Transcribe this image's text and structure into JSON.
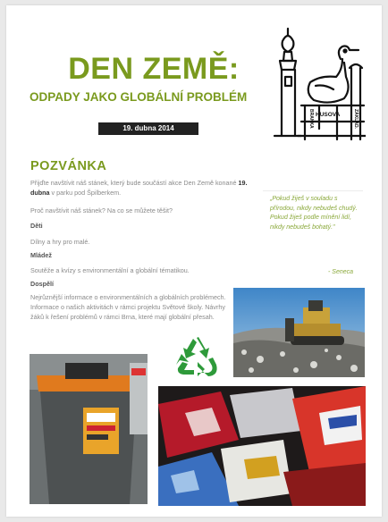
{
  "title": "DEN ZEMĚ:",
  "subtitle": "ODPADY JAKO GLOBÁLNÍ PROBLÉM",
  "date": "19. dubna 2014",
  "heading": "POZVÁNKA",
  "intro_parts": [
    "Přijďte navštívit náš stánek, který bude součástí akce Den Země konané ",
    "19. dubna",
    " v parku pod Špilberkem."
  ],
  "question": "Proč navštívit náš stánek? Na co se můžete těšit?",
  "sections": [
    {
      "label": "Děti",
      "text": "Dílny a hry pro malé."
    },
    {
      "label": "Mládež",
      "text": "Soutěže a kvízy s environmentální a globální tématikou."
    },
    {
      "label": "Dospělí",
      "text": "Nejrůznější informace o environmentálních a globálních problémech. Informace o našich aktivitách v rámci projektu Světové školy. Návrhy žáků k řešení problémů v rámci Brna, které mají globální přesah."
    }
  ],
  "quote": "„Pokud žiješ v souladu s přírodou, nikdy nebudeš chudý. Pokud žiješ podle mínění lidí, nikdy nebudeš bohatý.\"",
  "quote_author": "- Seneca",
  "logo_text": [
    "HUSOVA",
    "BRANKA",
    "ZÁKLAD."
  ],
  "colors": {
    "accent": "#7a9a1e",
    "quote": "#8aa83a",
    "date_bar": "#222222"
  },
  "icons": [
    "recycle-icon",
    "school-logo"
  ],
  "images": [
    "landfill-bulldozer-photo",
    "waste-bin-photo",
    "crushed-cans-trash-photo"
  ]
}
